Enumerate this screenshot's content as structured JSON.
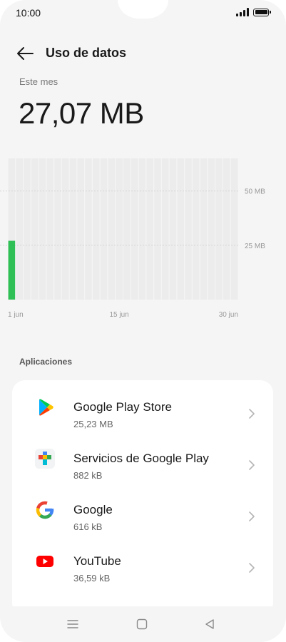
{
  "status": {
    "time": "10:00"
  },
  "header": {
    "title": "Uso de datos"
  },
  "usage": {
    "period_label": "Este mes",
    "total": "27,07 MB"
  },
  "chart_data": {
    "type": "bar",
    "days": 30,
    "values_mb": [
      27.07,
      0,
      0,
      0,
      0,
      0,
      0,
      0,
      0,
      0,
      0,
      0,
      0,
      0,
      0,
      0,
      0,
      0,
      0,
      0,
      0,
      0,
      0,
      0,
      0,
      0,
      0,
      0,
      0,
      0
    ],
    "ylim": [
      0,
      65
    ],
    "y_ticks": [
      {
        "value": 25,
        "label": "25 MB"
      },
      {
        "value": 50,
        "label": "50 MB"
      }
    ],
    "x_ticks": [
      {
        "day": 1,
        "label": "1 jun"
      },
      {
        "day": 15,
        "label": "15 jun"
      },
      {
        "day": 30,
        "label": "30 jun"
      }
    ],
    "bar_color": "#2ebf55"
  },
  "apps_section": {
    "title": "Aplicaciones",
    "items": [
      {
        "name": "Google Play Store",
        "size": "25,23 MB",
        "icon": "google-play-store-icon"
      },
      {
        "name": "Servicios de Google Play",
        "size": "882 kB",
        "icon": "google-play-services-icon"
      },
      {
        "name": "Google",
        "size": "616 kB",
        "icon": "google-icon"
      },
      {
        "name": "YouTube",
        "size": "36,59 kB",
        "icon": "youtube-icon"
      }
    ]
  },
  "nav": {
    "icons": [
      "menu-icon",
      "home-icon",
      "back-triangle-icon"
    ]
  }
}
